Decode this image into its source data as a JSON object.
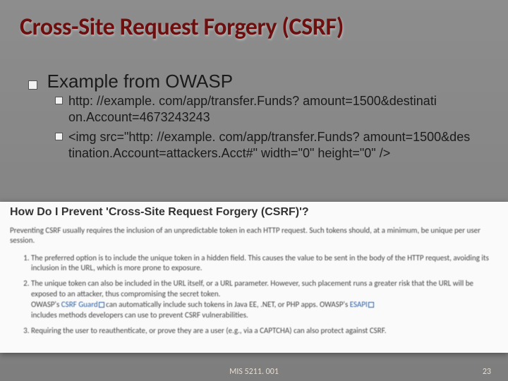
{
  "title": "Cross-Site Request Forgery (CSRF)",
  "example_heading": "Example from OWASP",
  "bullets": {
    "b1": "http: //example. com/app/transfer.Funds? amount=1500&destinati on.Account=4673243243",
    "b2": "<img src=\"http: //example. com/app/transfer.Funds? amount=1500&des tination.Account=attackers.Acct#\" width=\"0\" height=\"0\" />"
  },
  "panel": {
    "title": "How Do I Prevent 'Cross-Site Request Forgery (CSRF)'?",
    "lead": "Preventing CSRF usually requires the inclusion of an unpredictable token in each HTTP request. Such tokens should, at a minimum, be unique per user session.",
    "item1": "The preferred option is to include the unique token in a hidden field. This causes the value to be sent in the body of the HTTP request, avoiding its inclusion in the URL, which is more prone to exposure.",
    "item2a": "The unique token can also be included in the URL itself, or a URL parameter. However, such placement runs a greater risk that the URL will be exposed to an attacker, thus compromising the secret token.",
    "item2b_prefix": "OWASP's ",
    "item2b_link1": "CSRF Guard",
    "item2b_mid": " can automatically include such tokens in Java EE, .NET, or PHP apps. OWASP's ",
    "item2b_link2": "ESAPI",
    "item2b_suffix": " includes methods developers can use to prevent CSRF vulnerabilities.",
    "item3": "Requiring the user to reauthenticate, or prove they are a user (e.g., via a CAPTCHA) can also protect against CSRF."
  },
  "footer": {
    "course": "MIS 5211. 001",
    "page": "23"
  }
}
